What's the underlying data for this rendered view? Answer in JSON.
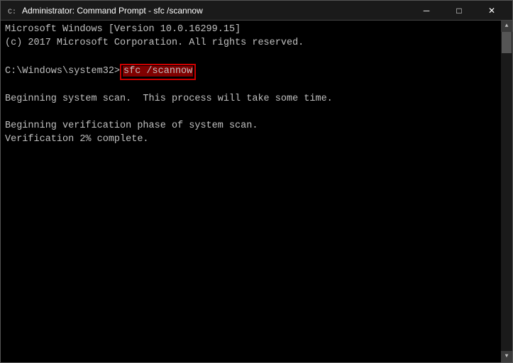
{
  "window": {
    "title": "Administrator: Command Prompt - sfc /scannow",
    "icon": "cmd"
  },
  "titlebar": {
    "minimize_label": "─",
    "maximize_label": "□",
    "close_label": "✕"
  },
  "terminal": {
    "line1": "Microsoft Windows [Version 10.0.16299.15]",
    "line2": "(c) 2017 Microsoft Corporation. All rights reserved.",
    "line3": "",
    "line4_prompt": "C:\\Windows\\system32>",
    "line4_command": "sfc /scannow",
    "line5": "",
    "line6": "Beginning system scan.  This process will take some time.",
    "line7": "",
    "line8": "Beginning verification phase of system scan.",
    "line9": "Verification 2% complete."
  }
}
